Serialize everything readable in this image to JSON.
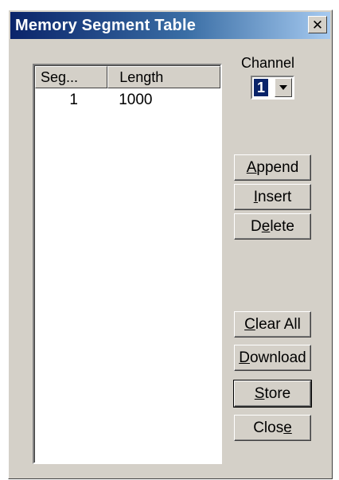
{
  "window": {
    "title": "Memory Segment  Table",
    "close_glyph": "✕"
  },
  "list": {
    "columns": [
      "Seg...",
      "Length"
    ],
    "rows": [
      {
        "seg": "1",
        "length": "1000"
      }
    ]
  },
  "channel": {
    "label": "Channel",
    "value": "1"
  },
  "buttons": {
    "append": {
      "pre": "",
      "key": "A",
      "post": "ppend"
    },
    "insert": {
      "pre": "",
      "key": "I",
      "post": "nsert"
    },
    "delete": {
      "pre": "D",
      "key": "e",
      "post": "lete"
    },
    "clear_all": {
      "pre": "",
      "key": "C",
      "post": "lear All"
    },
    "download": {
      "pre": "",
      "key": "D",
      "post": "ownload"
    },
    "store": {
      "pre": "",
      "key": "S",
      "post": "tore"
    },
    "close": {
      "pre": "Clos",
      "key": "e",
      "post": ""
    }
  }
}
